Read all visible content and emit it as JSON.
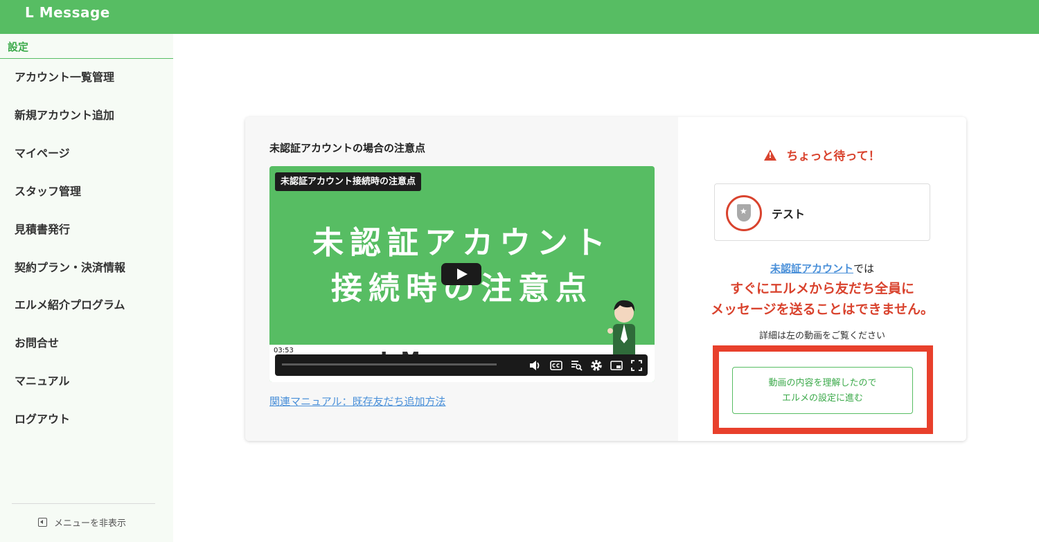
{
  "app": {
    "logo": "L Message"
  },
  "sidebar": {
    "section_title": "設定",
    "items": [
      {
        "label": "アカウント一覧管理"
      },
      {
        "label": "新規アカウント追加"
      },
      {
        "label": "マイページ"
      },
      {
        "label": "スタッフ管理"
      },
      {
        "label": "見積書発行"
      },
      {
        "label": "契約プラン・決済情報"
      },
      {
        "label": "エルメ紹介プログラム"
      },
      {
        "label": "お問合せ"
      },
      {
        "label": "マニュアル"
      },
      {
        "label": "ログアウト"
      }
    ],
    "hide_menu": "メニューを非表示"
  },
  "video_section": {
    "heading": "未認証アカウントの場合の注意点",
    "video_title": "未認証アカウント接続時の注意点",
    "thumb_line1": "未認証アカウント",
    "thumb_line2": "接続時の注意点",
    "watermark": "L Message",
    "timestamp": "03:53",
    "manual_link": "関連マニュアル：既存友だち追加方法"
  },
  "notice": {
    "warning": "ちょっと待って！",
    "account_name": "テスト",
    "link_text": "未認証アカウント",
    "link_suffix": "では",
    "red_line1": "すぐにエルメから友だち全員に",
    "red_line2": "メッセージを送ることはできません。",
    "detail": "詳細は左の動画をご覧ください",
    "button_line1": "動画の内容を理解したので",
    "button_line2": "エルメの設定に進む"
  },
  "colors": {
    "brand_green": "#57bd63",
    "warning_red": "#d9432e",
    "link_blue": "#4a90d9",
    "highlight_red": "#e8402c"
  }
}
